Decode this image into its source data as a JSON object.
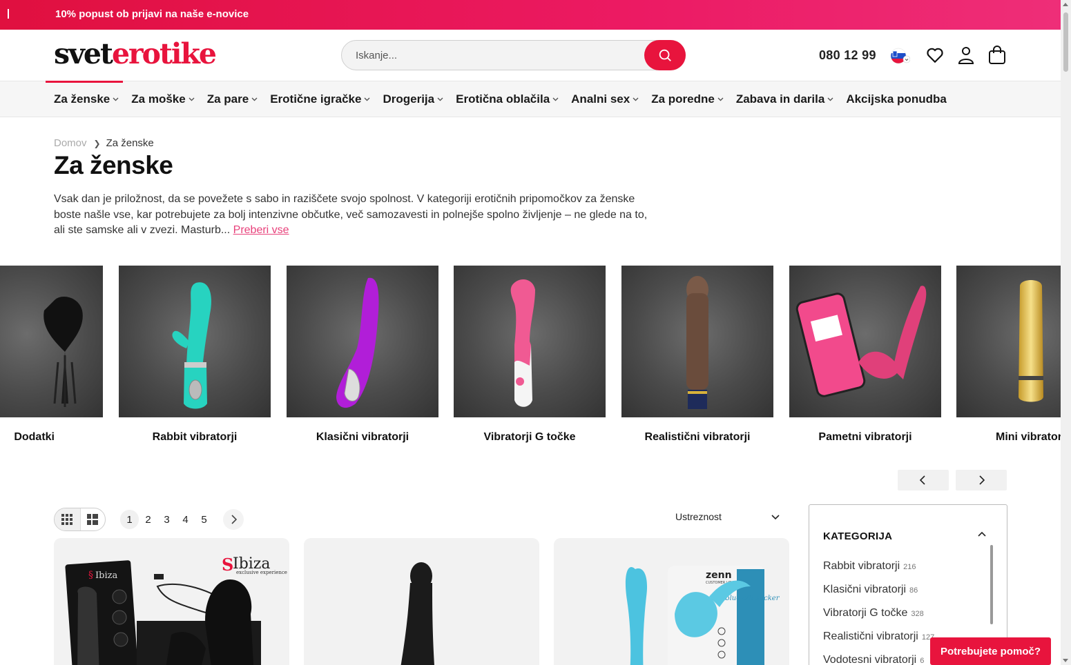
{
  "promo": {
    "text": "10% popust ob prijavi na naše e-novice"
  },
  "header": {
    "logo_part1": "svet",
    "logo_part2": "erotike",
    "search_placeholder": "Iskanje...",
    "phone": "080 12 99",
    "icons": [
      "search-icon",
      "flag-icon",
      "heart-icon",
      "user-icon",
      "bag-icon"
    ]
  },
  "nav": {
    "items": [
      {
        "label": "Za ženske",
        "dropdown": true
      },
      {
        "label": "Za moške",
        "dropdown": true
      },
      {
        "label": "Za pare",
        "dropdown": true
      },
      {
        "label": "Erotične igračke",
        "dropdown": true
      },
      {
        "label": "Drogerija",
        "dropdown": true
      },
      {
        "label": "Erotična oblačila",
        "dropdown": true
      },
      {
        "label": "Analni sex",
        "dropdown": true
      },
      {
        "label": "Za poredne",
        "dropdown": true
      },
      {
        "label": "Zabava in darila",
        "dropdown": true
      },
      {
        "label": "Akcijska ponudba",
        "dropdown": false
      }
    ]
  },
  "breadcrumb": {
    "home": "Domov",
    "current": "Za ženske"
  },
  "page": {
    "title": "Za ženske",
    "description": "Vsak dan je priložnost, da se povežete s sabo in raziščete svojo spolnost. V kategoriji erotičnih pripomočkov za ženske boste našle vse, kar potrebujete za bolj intenzivne občutke, več samozavesti in polnejše spolno življenje – ne glede na to, ali ste samske ali v zvezi. Masturb...",
    "read_more": "Preberi vse"
  },
  "categories": [
    {
      "label": "Dodatki"
    },
    {
      "label": "Rabbit vibratorji"
    },
    {
      "label": "Klasični vibratorji"
    },
    {
      "label": "Vibratorji G točke"
    },
    {
      "label": "Realistični vibratorji"
    },
    {
      "label": "Pametni vibratorji"
    },
    {
      "label": "Mini vibratorji"
    }
  ],
  "toolbar": {
    "pages": [
      "1",
      "2",
      "3",
      "4",
      "5"
    ],
    "current_page": "1",
    "sort_label": "Ustreznost"
  },
  "products": [
    {
      "brand": "Ibiza",
      "brand_sub": "exclusive experience"
    },
    {
      "brand": ""
    },
    {
      "brand": "zenn",
      "brand_sub": "CUSTOMER LOVING",
      "box_text": "The blue clit sucker"
    }
  ],
  "filter": {
    "heading": "KATEGORIJA",
    "items": [
      {
        "label": "Rabbit vibratorji",
        "count": "216"
      },
      {
        "label": "Klasični vibratorji",
        "count": "86"
      },
      {
        "label": "Vibratorji G točke",
        "count": "328"
      },
      {
        "label": "Realistični vibratorji",
        "count": "127"
      },
      {
        "label": "Vodotesni vibratorji",
        "count": "6"
      }
    ]
  },
  "help_button": "Potrebujete pomoč?",
  "colors": {
    "brand": "#e8143d",
    "promo_gradient_end": "#ee2e78",
    "link": "#e8407a"
  }
}
